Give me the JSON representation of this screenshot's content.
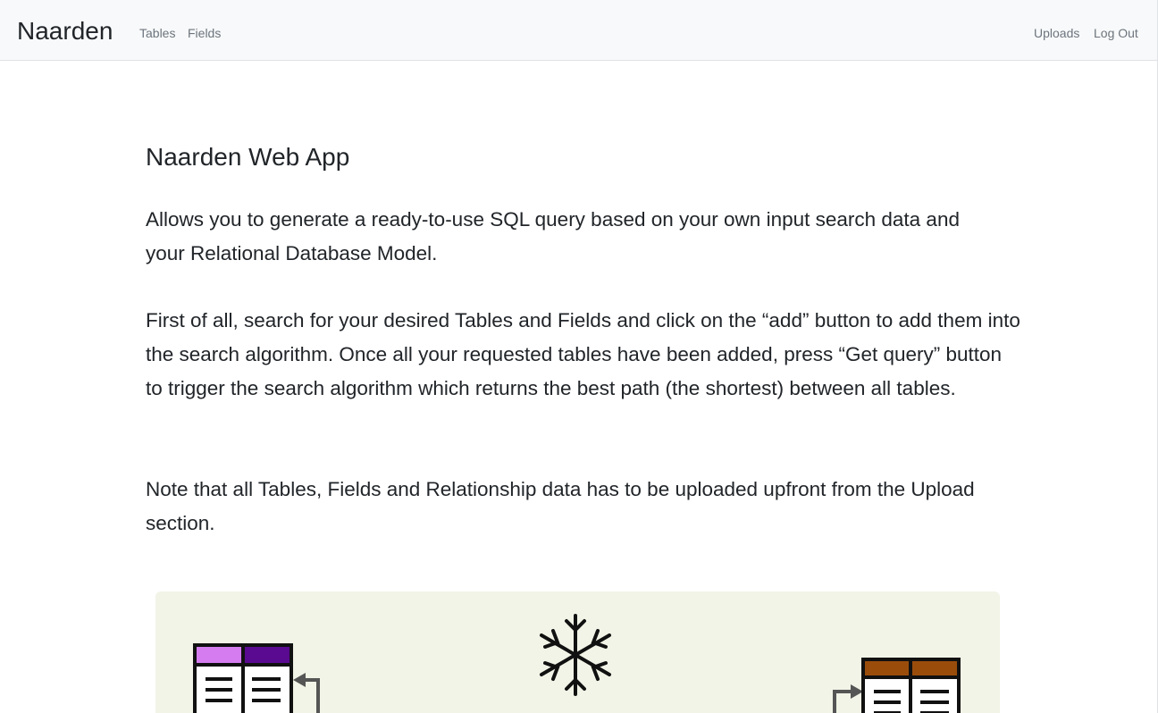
{
  "navbar": {
    "brand": "Naarden",
    "links": {
      "tables": "Tables",
      "fields": "Fields"
    },
    "right_links": {
      "uploads": "Uploads",
      "logout": "Log Out"
    }
  },
  "main": {
    "title": "Naarden Web App",
    "paragraphs": [
      "Allows you to generate a ready-to-use SQL query based on your own input search data and your Relational Database Model.",
      "First of all, search for your desired Tables and Fields and click on the “add” button to add them into the search algorithm. Once all your requested tables have been added, press “Get query” button to trigger the search algorithm which returns the best path (the shortest) between all tables.",
      "Note that all Tables, Fields and Relationship data has to be uploaded upfront from the Upload section."
    ]
  },
  "diagram": {
    "background": "#f1f4e6",
    "icons": [
      "table-icon",
      "snowflake-icon",
      "table-icon"
    ],
    "colors": {
      "left_table_header_light": "#d57cf0",
      "left_table_header_dark": "#5a0a90",
      "right_table_header": "#9a4d0b",
      "arrow": "#555555"
    }
  }
}
